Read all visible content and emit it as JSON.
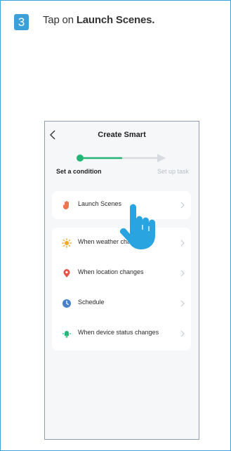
{
  "step": {
    "number": "3",
    "prefix": "Tap on ",
    "emphasis": "Launch Scenes."
  },
  "screen": {
    "title": "Create Smart",
    "steps": {
      "current": "Set a condition",
      "next": "Set up task",
      "progress": 0.5
    },
    "primary": {
      "label": "Launch Scenes",
      "icon": "launch-hand-icon"
    },
    "conditions": [
      {
        "label": "When weather changes",
        "icon": "sun-icon"
      },
      {
        "label": "When location changes",
        "icon": "location-pin-icon"
      },
      {
        "label": "Schedule",
        "icon": "clock-icon"
      },
      {
        "label": "When device status changes",
        "icon": "device-status-icon"
      }
    ]
  },
  "colors": {
    "accent": "#22b573",
    "badge": "#3b9fd8",
    "pointer": "#2aa4e1",
    "sun": "#f6a623",
    "pin": "#e8534a",
    "clock": "#4a80c8",
    "device": "#27b57a",
    "hand": "#ef7551"
  }
}
